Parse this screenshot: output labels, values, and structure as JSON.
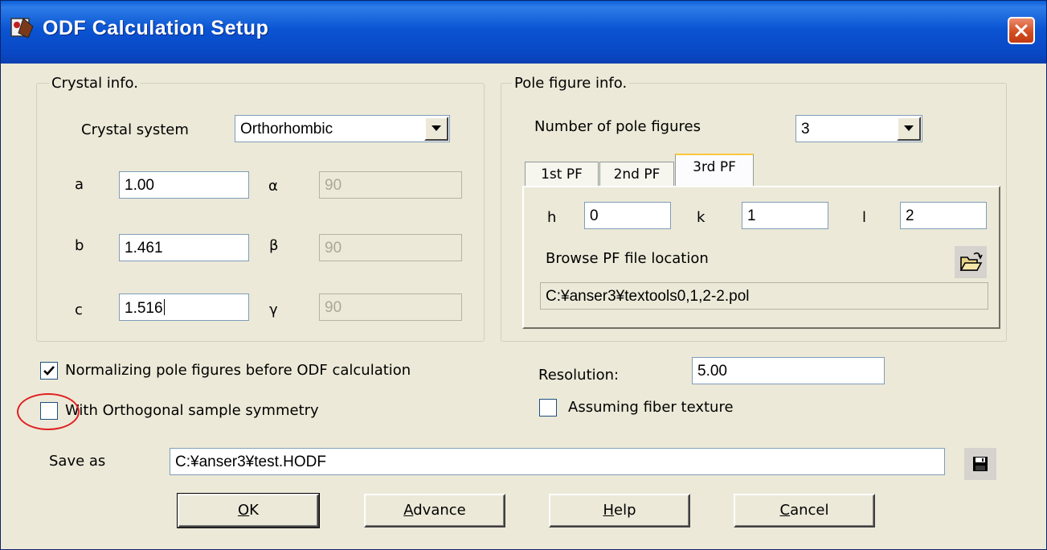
{
  "window": {
    "title": "ODF Calculation Setup"
  },
  "crystal": {
    "group_title": "Crystal info.",
    "system_label": "Crystal system",
    "system_value": "Orthorhombic",
    "a_label": "a",
    "a_value": "1.00",
    "b_label": "b",
    "b_value": "1.461",
    "c_label": "c",
    "c_value": "1.516",
    "alpha_label": "α",
    "alpha_value": "90",
    "beta_label": "β",
    "beta_value": "90",
    "gamma_label": "γ",
    "gamma_value": "90"
  },
  "pole": {
    "group_title": "Pole figure info.",
    "count_label": "Number of pole figures",
    "count_value": "3",
    "tabs": [
      "1st PF",
      "2nd PF",
      "3rd PF"
    ],
    "h_label": "h",
    "h_value": "0",
    "k_label": "k",
    "k_value": "1",
    "l_label": "l",
    "l_value": "2",
    "browse_label": "Browse PF file location",
    "file_path": "C:¥anser3¥textools0,1,2-2.pol"
  },
  "options": {
    "normalize_label": "Normalizing pole figures before ODF calculation",
    "normalize_checked": true,
    "orthogonal_label": "With Orthogonal sample symmetry",
    "orthogonal_checked": false,
    "resolution_label": "Resolution:",
    "resolution_value": "5.00",
    "fiber_label": "Assuming fiber texture",
    "fiber_checked": false
  },
  "save": {
    "label": "Save as",
    "path": "C:¥anser3¥test.HODF"
  },
  "buttons": {
    "ok_mnemonic": "O",
    "ok_rest": "K",
    "advance_mnemonic": "A",
    "advance_rest": "dvance",
    "help_mnemonic": "H",
    "help_rest": "elp",
    "cancel_mnemonic": "C",
    "cancel_rest": "ancel"
  },
  "colors": {
    "titlebar": "#0a54d2",
    "dialog_bg": "#ece9d8",
    "close_btn": "#d04a1e",
    "highlight": "#e02020"
  },
  "icons": [
    "app-icon",
    "close-icon",
    "dropdown-arrow-icon",
    "open-folder-icon",
    "save-disk-icon",
    "checkmark-icon"
  ]
}
